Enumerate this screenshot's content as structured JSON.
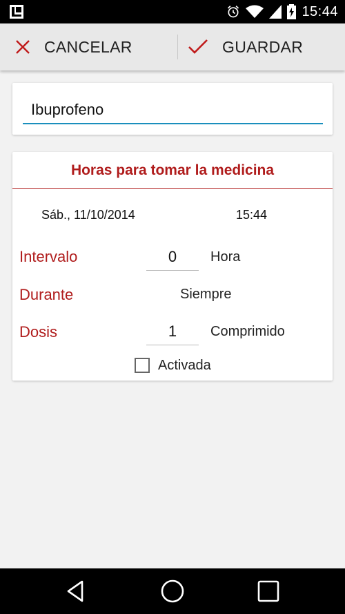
{
  "status_bar": {
    "time": "15:44",
    "icons": [
      "app-notification-icon",
      "alarm-icon",
      "wifi-icon",
      "signal-icon",
      "battery-charging-icon"
    ]
  },
  "action_bar": {
    "cancel_label": "CANCELAR",
    "save_label": "GUARDAR",
    "cancel_icon": "close-icon",
    "save_icon": "check-icon"
  },
  "medicine": {
    "name": "Ibuprofeno"
  },
  "schedule": {
    "title": "Horas para tomar la medicina",
    "date": "Sáb., 11/10/2014",
    "time": "15:44",
    "interval": {
      "label": "Intervalo",
      "value": "0",
      "unit": "Hora"
    },
    "during": {
      "label": "Durante",
      "value": "Siempre"
    },
    "dose": {
      "label": "Dosis",
      "value": "1",
      "unit": "Comprimido"
    },
    "activated": {
      "label": "Activada",
      "checked": false
    }
  },
  "colors": {
    "accent_red": "#b01c1c",
    "input_underline_blue": "#1a8fbd"
  },
  "nav_bar": {
    "icons": [
      "back-icon",
      "home-icon",
      "recents-icon"
    ]
  }
}
